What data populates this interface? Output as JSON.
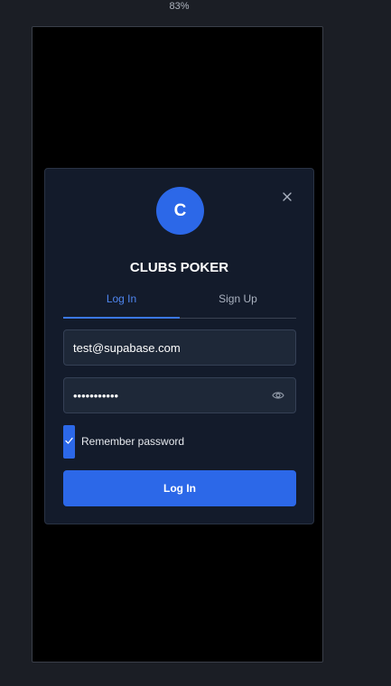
{
  "zoom_level": "83%",
  "modal": {
    "avatar_letter": "C",
    "title": "CLUBS POKER",
    "tabs": [
      {
        "label": "Log In",
        "active": true
      },
      {
        "label": "Sign Up",
        "active": false
      }
    ],
    "email": {
      "value": "test@supabase.com"
    },
    "password": {
      "value": "•••••••••••",
      "show_icon": "eye-icon"
    },
    "remember": {
      "label": "Remember password",
      "checked": true
    },
    "submit_label": "Log In",
    "close_icon": "close-icon"
  },
  "colors": {
    "accent": "#2c68e8",
    "active_tab": "#4f86f0",
    "modal_bg": "#131b2b",
    "page_bg": "#1b1e25"
  }
}
